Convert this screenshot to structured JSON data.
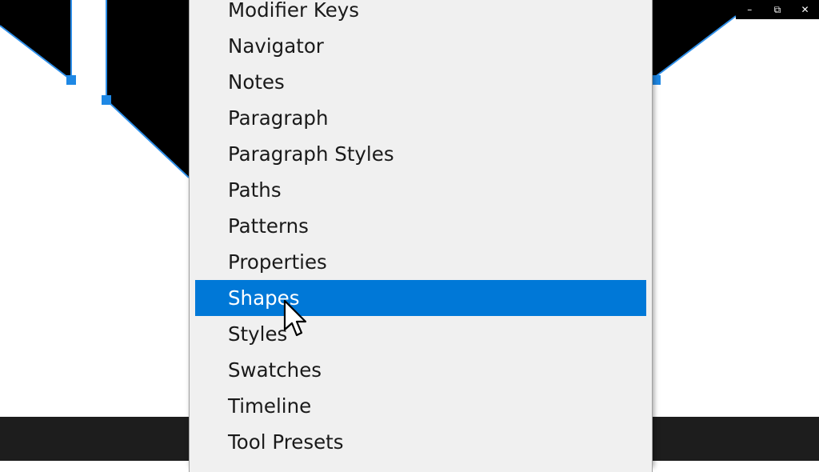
{
  "window_controls": {
    "minimize": "–",
    "restore": "⧉",
    "close": "✕"
  },
  "menu": {
    "items": [
      {
        "label": "Modifier Keys",
        "selected": false
      },
      {
        "label": "Navigator",
        "selected": false
      },
      {
        "label": "Notes",
        "selected": false
      },
      {
        "label": "Paragraph",
        "selected": false
      },
      {
        "label": "Paragraph Styles",
        "selected": false
      },
      {
        "label": "Paths",
        "selected": false
      },
      {
        "label": "Patterns",
        "selected": false
      },
      {
        "label": "Properties",
        "selected": false
      },
      {
        "label": "Shapes",
        "selected": true
      },
      {
        "label": "Styles",
        "selected": false
      },
      {
        "label": "Swatches",
        "selected": false
      },
      {
        "label": "Timeline",
        "selected": false
      },
      {
        "label": "Tool Presets",
        "selected": false
      }
    ]
  },
  "colors": {
    "selection": "#0078d7",
    "anchor": "#1e88e5",
    "path": "#2f8fe8",
    "menu_bg": "#f0f0f0"
  },
  "icons": {
    "pointer": "arrow-cursor-icon"
  }
}
